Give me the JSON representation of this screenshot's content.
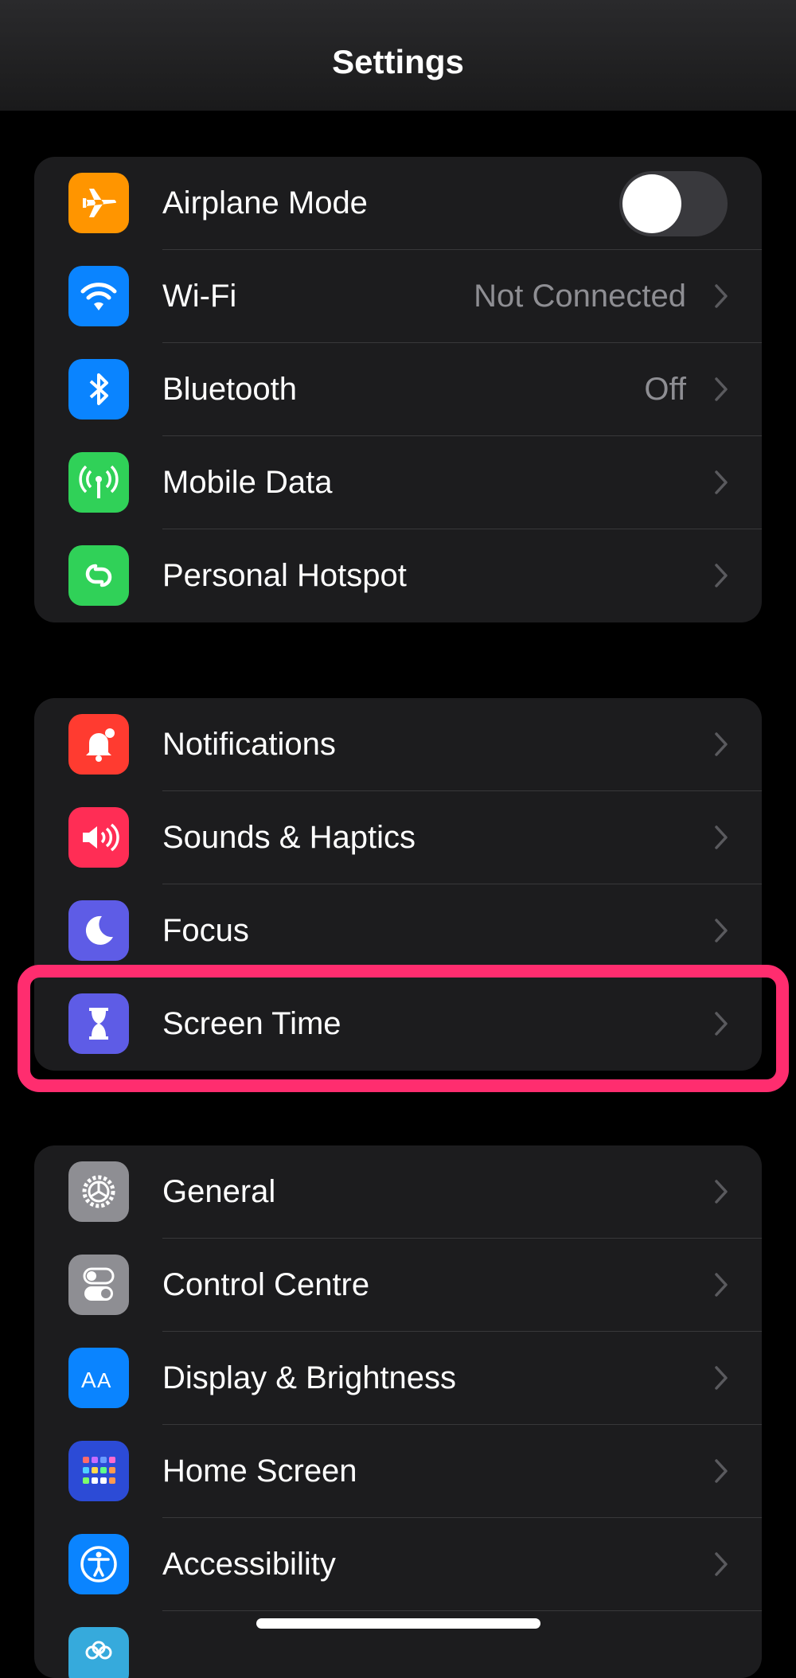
{
  "header": {
    "title": "Settings"
  },
  "groups": [
    {
      "items": [
        {
          "label": "Airplane Mode",
          "icon": "airplane-icon",
          "color": "#ff9500",
          "toggle": false
        },
        {
          "label": "Wi-Fi",
          "icon": "wifi-icon",
          "color": "#0a84ff",
          "value": "Not Connected"
        },
        {
          "label": "Bluetooth",
          "icon": "bluetooth-icon",
          "color": "#0a84ff",
          "value": "Off"
        },
        {
          "label": "Mobile Data",
          "icon": "antenna-icon",
          "color": "#30d158"
        },
        {
          "label": "Personal Hotspot",
          "icon": "hotspot-icon",
          "color": "#30d158"
        }
      ]
    },
    {
      "items": [
        {
          "label": "Notifications",
          "icon": "bell-icon",
          "color": "#ff3b30"
        },
        {
          "label": "Sounds & Haptics",
          "icon": "speaker-icon",
          "color": "#ff2d55"
        },
        {
          "label": "Focus",
          "icon": "moon-icon",
          "color": "#5e5ce6"
        },
        {
          "label": "Screen Time",
          "icon": "hourglass-icon",
          "color": "#5e5ce6",
          "highlighted": true
        }
      ]
    },
    {
      "items": [
        {
          "label": "General",
          "icon": "gear-icon",
          "color": "#8e8e93"
        },
        {
          "label": "Control Centre",
          "icon": "switches-icon",
          "color": "#8e8e93"
        },
        {
          "label": "Display & Brightness",
          "icon": "text-size-icon",
          "color": "#0a84ff"
        },
        {
          "label": "Home Screen",
          "icon": "app-grid-icon",
          "color": "#2c4bd6"
        },
        {
          "label": "Accessibility",
          "icon": "accessibility-icon",
          "color": "#0a84ff"
        },
        {
          "label": "",
          "icon": "wallpaper-icon",
          "color": "#36aadc"
        }
      ]
    }
  ],
  "highlight_color": "#ff2d6f"
}
